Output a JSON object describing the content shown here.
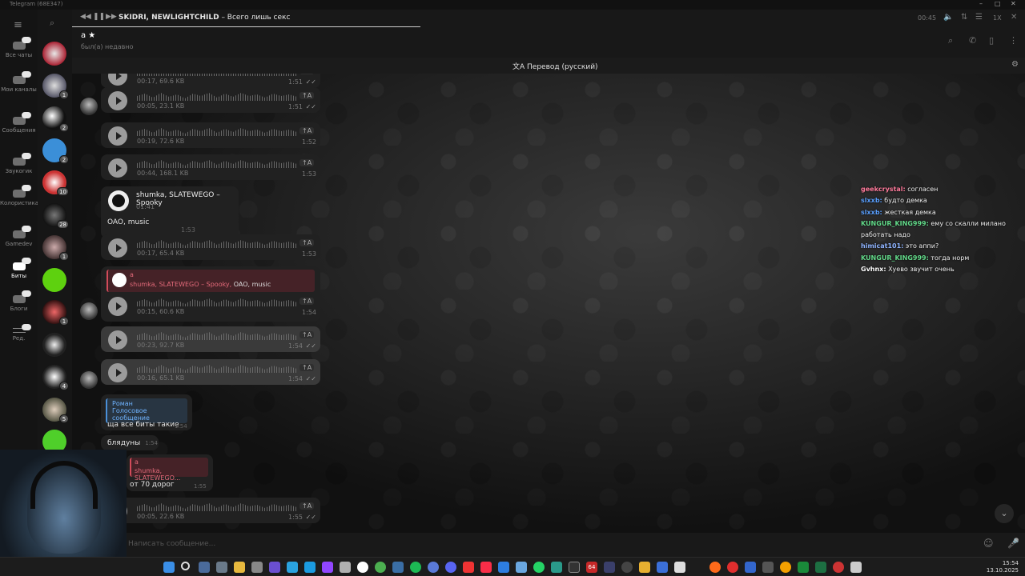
{
  "window": {
    "title": "Telegram (68E347)"
  },
  "folders": [
    {
      "label": "Все чаты",
      "active": false
    },
    {
      "label": "Мои каналы",
      "active": false
    },
    {
      "label": "Сообщения",
      "active": false
    },
    {
      "label": "Звукогик",
      "active": false
    },
    {
      "label": "Колористика",
      "active": false
    },
    {
      "label": "Gamedev",
      "active": false
    },
    {
      "label": "Биты",
      "active": true
    },
    {
      "label": "Блоги",
      "active": false
    },
    {
      "label": "Ред.",
      "active": false
    }
  ],
  "chatlist_badges": [
    "",
    "1",
    "2",
    "2",
    "10",
    "28",
    "1",
    "",
    "1",
    "",
    "4",
    "5",
    ""
  ],
  "player": {
    "artist": "SKIDRI, NEWLIGHTCHILD",
    "title": "– Всего лишь секс",
    "time": "00:45",
    "speed": "1X"
  },
  "chat": {
    "name": "a ★",
    "status": "был(а) недавно"
  },
  "translate": {
    "label": "Перевод (русский)"
  },
  "messages": {
    "v0": {
      "meta": "00:17, 69.6 KB",
      "time": "1:51"
    },
    "v1": {
      "meta": "00:05, 23.1 KB",
      "time": "1:51"
    },
    "v2": {
      "meta": "00:19, 72.6 KB",
      "time": "1:52"
    },
    "v3": {
      "meta": "00:44, 168.1 KB",
      "time": "1:53"
    },
    "music": {
      "title": "shumka, SLATEWEGO – Spooky",
      "duration": "01:41"
    },
    "caption": {
      "text": "OAO, music",
      "time": "1:53"
    },
    "v4": {
      "meta": "00:17, 65.4 KB",
      "time": "1:53"
    },
    "reply1": {
      "name": "a",
      "track": "shumka, SLATEWEGO – Spooky,",
      "extra": " OAO, music"
    },
    "v5": {
      "meta": "00:15, 60.6 KB",
      "time": "1:54"
    },
    "v6": {
      "meta": "00:23, 92.7 KB",
      "time": "1:54"
    },
    "v7": {
      "meta": "00:16, 65.1 KB",
      "time": "1:54"
    },
    "quote": {
      "name": "Роман",
      "text": "Голосовое сообщение"
    },
    "t1": {
      "text": "ща все биты такие",
      "time": "1:54"
    },
    "t2": {
      "text": "блядуны",
      "time": "1:54"
    },
    "reply2": {
      "name": "a",
      "track": "shumka, SLATEWEGO..."
    },
    "t3": {
      "text": "от 70 дорог",
      "time": "1:55"
    },
    "v8": {
      "meta": "00:05, 22.6 KB",
      "time": "1:55"
    },
    "translate_btn": "↑A"
  },
  "stream_chat": [
    {
      "user": "geekcrystal:",
      "text": " согласен",
      "color": "#ff7b9c"
    },
    {
      "user": "slxxb:",
      "text": " будто демка",
      "color": "#5aa0ff"
    },
    {
      "user": "slxxb:",
      "text": " жесткая демка",
      "color": "#5aa0ff"
    },
    {
      "user": "KUNGUR_KING999:",
      "text": " ему со скалли милано работать надо",
      "color": "#62d989"
    },
    {
      "user": "himicat101:",
      "text": " это аппи?",
      "color": "#8fb4ff"
    },
    {
      "user": "KUNGUR_KING999:",
      "text": " тогда норм",
      "color": "#62d989"
    },
    {
      "user": "Gvhnx:",
      "text": " Хуево звучит очень",
      "color": "#ffffff"
    }
  ],
  "composer": {
    "placeholder": "Написать сообщение..."
  },
  "taskbar": {
    "time": "15:54",
    "date": "13.10.2025",
    "badge": "64"
  }
}
